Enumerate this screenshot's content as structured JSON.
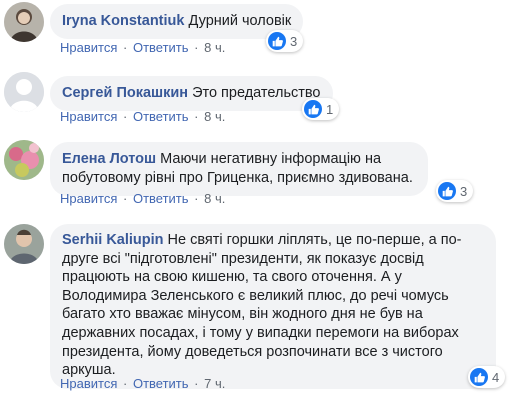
{
  "comments": [
    {
      "author": "Iryna Konstantiuk",
      "text": "Дурний чоловік",
      "like_label": "Нравится",
      "reply_label": "Ответить",
      "time": "8 ч.",
      "reaction_count": "3"
    },
    {
      "author": "Сергей Покашкин",
      "text": "Это предательство",
      "like_label": "Нравится",
      "reply_label": "Ответить",
      "time": "8 ч.",
      "reaction_count": "1"
    },
    {
      "author": "Елена Лотош",
      "text": "Маючи негативну інформацію на побутовому рівні про Гриценка, приємно здивована.",
      "like_label": "Нравится",
      "reply_label": "Ответить",
      "time": "8 ч.",
      "reaction_count": "3"
    },
    {
      "author": "Serhii Kaliupin",
      "text": "Не святі горшки ліплять, це по-перше, а по-друге всі \"підготовлені\" президенти, як показує досвід працюють на свою кишеню, та свого оточення. А у Володимира Зеленського є великий плюс, до речі чомусь багато хто вважає мінусом, він жодного дня не був на державних посадах, і тому у випадки перемоги на виборах президента, йому доведеться розпочинати все з чистого аркуша.",
      "like_label": "Нравится",
      "reply_label": "Ответить",
      "time": "7 ч.",
      "reaction_count": "4"
    }
  ],
  "separator": "·",
  "icons": {
    "like": "thumbs-up-icon"
  },
  "colors": {
    "link": "#385898",
    "bubble": "#f2f3f5",
    "like_badge": "#1877f2"
  }
}
